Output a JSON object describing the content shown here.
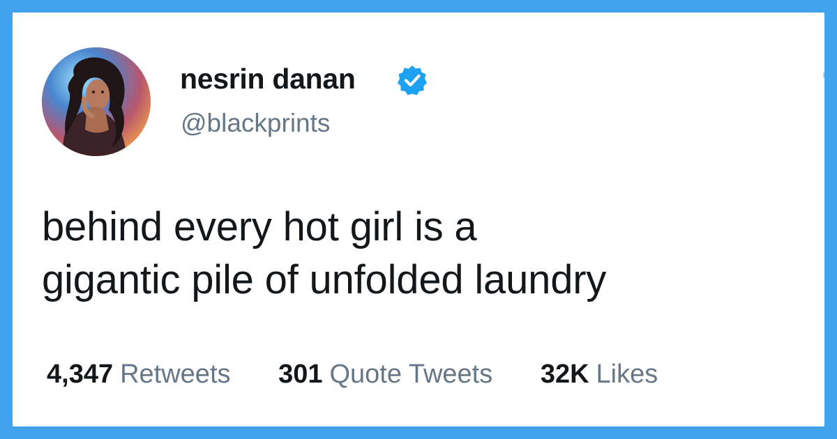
{
  "profile": {
    "display_name": "nesrin danan",
    "handle": "@blackprints",
    "verified_icon": "verified-badge-icon",
    "avatar": "profile-photo"
  },
  "tweet": {
    "lines": [
      "behind every hot girl is a",
      "gigantic pile of unfolded laundry"
    ]
  },
  "stats": {
    "retweets": {
      "count": "4,347",
      "label": "Retweets"
    },
    "quote_tweets": {
      "count": "301",
      "label": "Quote Tweets"
    },
    "likes": {
      "count": "32K",
      "label": "Likes"
    }
  },
  "colors": {
    "frame_border": "#3fa2ea",
    "text_primary": "#14171a",
    "text_secondary": "#657786",
    "verified": "#1da1f2"
  }
}
